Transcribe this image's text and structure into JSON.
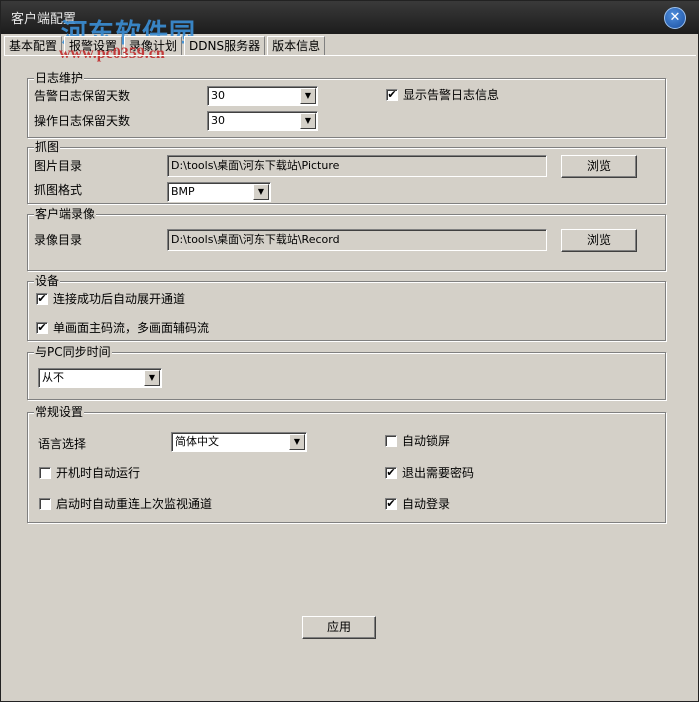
{
  "window": {
    "title": "客户端配置",
    "watermark": "河东软件园",
    "watermark_url": "www.pc0359.cn",
    "close_glyph": "✕"
  },
  "tabs": [
    {
      "label": "基本配置"
    },
    {
      "label": "报警设置"
    },
    {
      "label": "录像计划"
    },
    {
      "label": "DDNS服务器"
    },
    {
      "label": "版本信息"
    }
  ],
  "log": {
    "title": "日志维护",
    "alarm_days_label": "告警日志保留天数",
    "alarm_days_value": "30",
    "op_days_label": "操作日志保留天数",
    "op_days_value": "30",
    "show_alarm_label": "显示告警日志信息",
    "show_alarm_checked": "✔"
  },
  "capture": {
    "title": "抓图",
    "dir_label": "图片目录",
    "dir_value": "D:\\tools\\桌面\\河东下载站\\Picture",
    "browse_label": "浏览",
    "format_label": "抓图格式",
    "format_value": "BMP"
  },
  "record": {
    "title": "客户端录像",
    "dir_label": "录像目录",
    "dir_value": "D:\\tools\\桌面\\河东下载站\\Record",
    "browse_label": "浏览"
  },
  "device": {
    "title": "设备",
    "auto_expand_label": "连接成功后自动展开通道",
    "auto_expand_checked": "✔",
    "stream_label": "单画面主码流，多画面辅码流",
    "stream_checked": "✔"
  },
  "sync": {
    "title": "与PC同步时间",
    "value": "从不"
  },
  "general": {
    "title": "常规设置",
    "language_label": "语言选择",
    "language_value": "简体中文",
    "autostart_label": "开机时自动运行",
    "autostart_checked": "",
    "reconnect_label": "启动时自动重连上次监视通道",
    "reconnect_checked": "",
    "autolock_label": "自动锁屏",
    "autolock_checked": "",
    "exit_pwd_label": "退出需要密码",
    "exit_pwd_checked": "✔",
    "autologin_label": "自动登录",
    "autologin_checked": "✔"
  },
  "apply_label": "应用",
  "dropdown_glyph": "▼"
}
